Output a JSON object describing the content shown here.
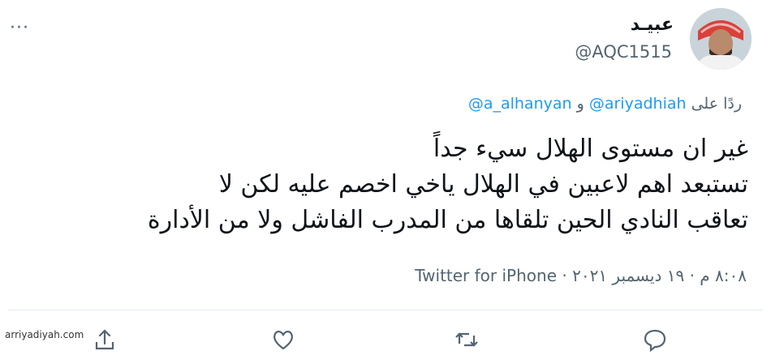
{
  "tweet": {
    "author_name": "عبيـد",
    "author_handle": "@AQC1515",
    "more_label": "···",
    "reply_prefix": "ردًا على",
    "reply_mention_1": "@ariyadhiah",
    "reply_joiner": "و",
    "reply_mention_2": "@a_alhanyan",
    "lines": [
      "غير ان مستوى الهلال سيء جداً",
      "تستبعد اهم لاعبين في الهلال ياخي اخصم عليه لكن لا",
      "تعاقب النادي الحين تلقاها من المدرب الفاشل ولا من الأدارة"
    ],
    "timestamp": "٨:٠٨ م · ١٩ ديسمبر ٢٠٢١",
    "client": "Twitter for iPhone"
  },
  "actions": {
    "icons": [
      "share-icon",
      "like-icon",
      "retweet-icon",
      "reply-icon"
    ]
  },
  "watermark": "arriyadiyah.com",
  "colors": {
    "link": "#1d9bf0",
    "secondary_text": "#536471",
    "primary_text": "#0f1419"
  }
}
